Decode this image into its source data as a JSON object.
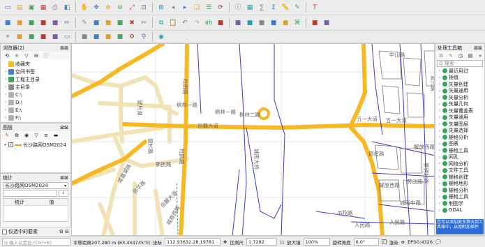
{
  "toolbar": {
    "row1": [
      "new-project",
      "open-project",
      "save-project",
      "save-as",
      "print-layout",
      "style-manager",
      "pan",
      "pan-to-selection",
      "zoom-in",
      "zoom-out",
      "zoom-full",
      "zoom-selection",
      "zoom-layer",
      "zoom-last",
      "zoom-next",
      "new-bookmark",
      "show-bookmarks",
      "refresh",
      "identify",
      "attribute-table",
      "field-calc",
      "stats",
      "measure",
      "annotation",
      "text"
    ],
    "row2": [
      "data-source-manager",
      "add-vector",
      "add-raster",
      "add-postgis",
      "add-wms",
      "digitize",
      "edit",
      "save-edits",
      "add-feature",
      "vertex-tool",
      "delete",
      "cut",
      "copy",
      "paste",
      "undo",
      "redo",
      "label",
      "label-pin",
      "label-show",
      "label-move",
      "label-rotate",
      "label-props",
      "diagram",
      "python",
      "plugin-a",
      "plugin-b"
    ],
    "row3": [
      "snap",
      "snap-a",
      "snap-b",
      "snap-c",
      "snap-d",
      "select",
      "select-value",
      "deselect",
      "measure-tool",
      "gps",
      "gear",
      "search",
      "chat"
    ]
  },
  "browser": {
    "title": "浏览器(2)",
    "items": [
      {
        "label": "收藏夹",
        "color": "#f0c020",
        "expand": ""
      },
      {
        "label": "空间书签",
        "color": "#4a7fc0",
        "expand": "›"
      },
      {
        "label": "工程主目录",
        "color": "#3aa55a",
        "expand": "›"
      },
      {
        "label": "主目录",
        "color": "#8a8a8a",
        "expand": "›"
      },
      {
        "label": "C:\\",
        "color": "#b0b0b0",
        "expand": "›"
      },
      {
        "label": "D:\\",
        "color": "#b0b0b0",
        "expand": "›"
      },
      {
        "label": "E:\\",
        "color": "#b0b0b0",
        "expand": "›"
      },
      {
        "label": "F:\\",
        "color": "#b0b0b0",
        "expand": "›"
      },
      {
        "label": "G:\\",
        "color": "#b0b0b0",
        "expand": ""
      }
    ]
  },
  "layers": {
    "title": "图层",
    "item": "长沙路网OSM2024",
    "checkbox": "√"
  },
  "stats": {
    "title": "统计",
    "layer_select": "长沙路网OSM2024",
    "field_placeholder": "",
    "col_stat": "统计",
    "col_value": "值",
    "only_selected": "仅选中的要素"
  },
  "search": {
    "placeholder": "Q 输入以定位 (Ctrl+K)"
  },
  "processing": {
    "title": "处理工具箱",
    "search_placeholder": "Q 搜索",
    "items": [
      "最近用过",
      "插值",
      "矢量创建",
      "矢量通用",
      "矢量分析",
      "矢量几何",
      "矢量覆盖表",
      "矢量通用",
      "矢量图层",
      "矢量选择",
      "栅格分析",
      "图表",
      "栅格工具",
      "网孔",
      "网络分析",
      "文件工具",
      "栅格创建",
      "栅格地形",
      "栅格分析",
      "栅格工具",
      "制图学",
      "GDAL"
    ],
    "footer": "您可以添加更多算法到工具箱中，启用附加插件"
  },
  "map": {
    "labels": [
      "枫林一路",
      "枫林二路",
      "枫林一路",
      "杜鹃路",
      "杜鹃路",
      "望月湖",
      "银杉路",
      "新民路",
      "岳华路",
      "岳麓大道",
      "咸嘉湖路",
      "岳麓大道",
      "城南西路",
      "中山路",
      "五一大道",
      "五一大道",
      "黄兴路",
      "解放西路",
      "解放西路",
      "蔡锷北路",
      "人民路",
      "人民路",
      "劳动路",
      "银星路",
      "书院路",
      "城南中路"
    ],
    "bridge_label": "城南大桥"
  },
  "statusbar": {
    "coord_label": "坐标",
    "coordinate": "112.93632,28.19781",
    "scale_label": "比例尺",
    "scale": "1:7292",
    "magnifier_label": "放大镜",
    "magnifier": "100%",
    "rotation_label": "旋转角度",
    "rotation": "0.0°",
    "render_label": "渲染",
    "crs": "EPSG:4326",
    "message": "平移距离207.280 m (63.334735°E)"
  }
}
